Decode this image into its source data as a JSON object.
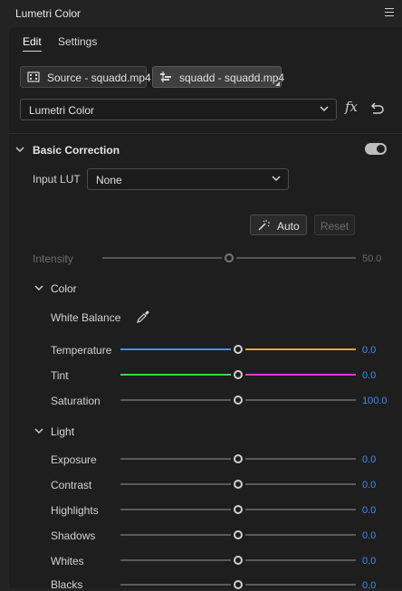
{
  "panel": {
    "title": "Lumetri Color"
  },
  "tabs": [
    {
      "label": "Edit",
      "active": true
    },
    {
      "label": "Settings",
      "active": false
    }
  ],
  "clips": {
    "source_label": "Source - squadd.mp4",
    "sequence_label": "squadd - squadd.mp4"
  },
  "effect_select": {
    "value": "Lumetri Color"
  },
  "fx_label": "fx",
  "basic_correction": {
    "title": "Basic Correction",
    "enabled": true,
    "input_lut": {
      "label": "Input LUT",
      "value": "None"
    },
    "auto_label": "Auto",
    "reset_label": "Reset",
    "intensity": {
      "label": "Intensity",
      "value": "50.0",
      "fraction": 0.5
    },
    "color": {
      "title": "Color",
      "white_balance_label": "White Balance",
      "rows": [
        {
          "label": "Temperature",
          "value": "0.0",
          "fraction": 0.5
        },
        {
          "label": "Tint",
          "value": "0.0",
          "fraction": 0.5
        },
        {
          "label": "Saturation",
          "value": "100.0",
          "fraction": 0.5
        }
      ]
    },
    "light": {
      "title": "Light",
      "rows": [
        {
          "label": "Exposure",
          "value": "0.0",
          "fraction": 0.5
        },
        {
          "label": "Contrast",
          "value": "0.0",
          "fraction": 0.5
        },
        {
          "label": "Highlights",
          "value": "0.0",
          "fraction": 0.5
        },
        {
          "label": "Shadows",
          "value": "0.0",
          "fraction": 0.5
        },
        {
          "label": "Whites",
          "value": "0.0",
          "fraction": 0.5
        },
        {
          "label": "Blacks",
          "value": "0.0",
          "fraction": 0.5
        }
      ]
    }
  },
  "colors": {
    "value_blue": "#3f8cf0",
    "temperature_cool": "#4a8fe0",
    "temperature_warm": "#e8a04a",
    "tint_green": "#3fd63f",
    "tint_magenta": "#d63fd6",
    "neutral_track": "#5a5a5a"
  },
  "icons": {
    "source_clip": "film-strip-icon",
    "sequence_clip": "timeline-icon",
    "dropdown": "chevron-down-icon",
    "fx": "fx-icon",
    "reset_effect": "undo-icon",
    "auto": "magic-wand-icon",
    "white_balance": "eyedropper-icon",
    "section_toggle": "chevron-down-icon"
  }
}
